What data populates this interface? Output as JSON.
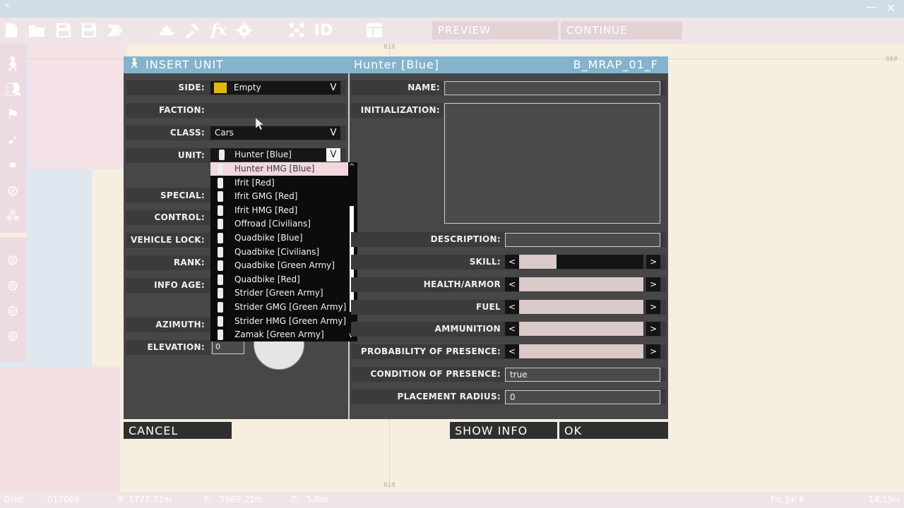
{
  "toolbar": {
    "preview_label": "PREVIEW",
    "continue_label": "CONTINUE",
    "id_label": "ID",
    "fx_label": "fx"
  },
  "map": {
    "grid_label_top": "018",
    "grid_label_right": "060",
    "grid_label_bottom": "018"
  },
  "dialog": {
    "title": "INSERT UNIT",
    "unit_header": "Hunter   [Blue]",
    "class_header": "B_MRAP_01_F",
    "left": {
      "side_label": "SIDE:",
      "side_value": "Empty",
      "faction_label": "FACTION:",
      "class_label": "CLASS:",
      "class_value": "Cars",
      "unit_label": "UNIT:",
      "unit_value": "Hunter   [Blue]",
      "special_label": "SPECIAL:",
      "control_label": "CONTROL:",
      "vehicle_lock_label": "VEHICLE LOCK:",
      "rank_label": "RANK:",
      "info_age_label": "INFO AGE:",
      "azimuth_label": "AZIMUTH:",
      "elevation_label": "ELEVATION:",
      "elevation_value": "0"
    },
    "right": {
      "name_label": "NAME:",
      "name_value": "",
      "init_label": "INITIALIZATION:",
      "init_value": "",
      "description_label": "DESCRIPTION:",
      "description_value": "",
      "skill_label": "SKILL:",
      "skill_level": 0.3,
      "health_label": "HEALTH/ARMOR",
      "health_level": 1.0,
      "fuel_label": "FUEL",
      "fuel_level": 1.0,
      "ammo_label": "AMMUNITION",
      "ammo_level": 1.0,
      "presence_prob_label": "PROBABILITY OF PRESENCE:",
      "presence_prob_level": 1.0,
      "presence_cond_label": "CONDITION OF PRESENCE:",
      "presence_cond_value": "true",
      "placement_label": "PLACEMENT RADIUS:",
      "placement_value": "0",
      "slider_left": "<",
      "slider_right": ">"
    },
    "dropdown_arrow": "V",
    "unit_list": [
      "Hunter HMG   [Blue]",
      "Ifrit   [Red]",
      "Ifrit GMG   [Red]",
      "Ifrit HMG   [Red]",
      "Offroad   [Civilians]",
      "Quadbike   [Blue]",
      "Quadbike   [Civilians]",
      "Quadbike   [Green Army]",
      "Quadbike   [Red]",
      "Strider   [Green Army]",
      "Strider GMG   [Green Army]",
      "Strider HMG   [Green Army]",
      "Zamak   [Green Army]"
    ],
    "scroll_up": "^",
    "scroll_down": "v",
    "cancel_label": "CANCEL",
    "show_info_label": "SHOW INFO",
    "ok_label": "OK"
  },
  "statusbar": {
    "grid_label": "Grid:",
    "grid_value": "017069",
    "x_label": "X:",
    "x_value": "1777.31m",
    "y_label": "Y:",
    "y_value": "5969.21m",
    "z_label": "Z:",
    "z_value": "5.6m",
    "date": "Fri, Jul 6",
    "time": "14:15",
    "time_suffix": "01"
  }
}
